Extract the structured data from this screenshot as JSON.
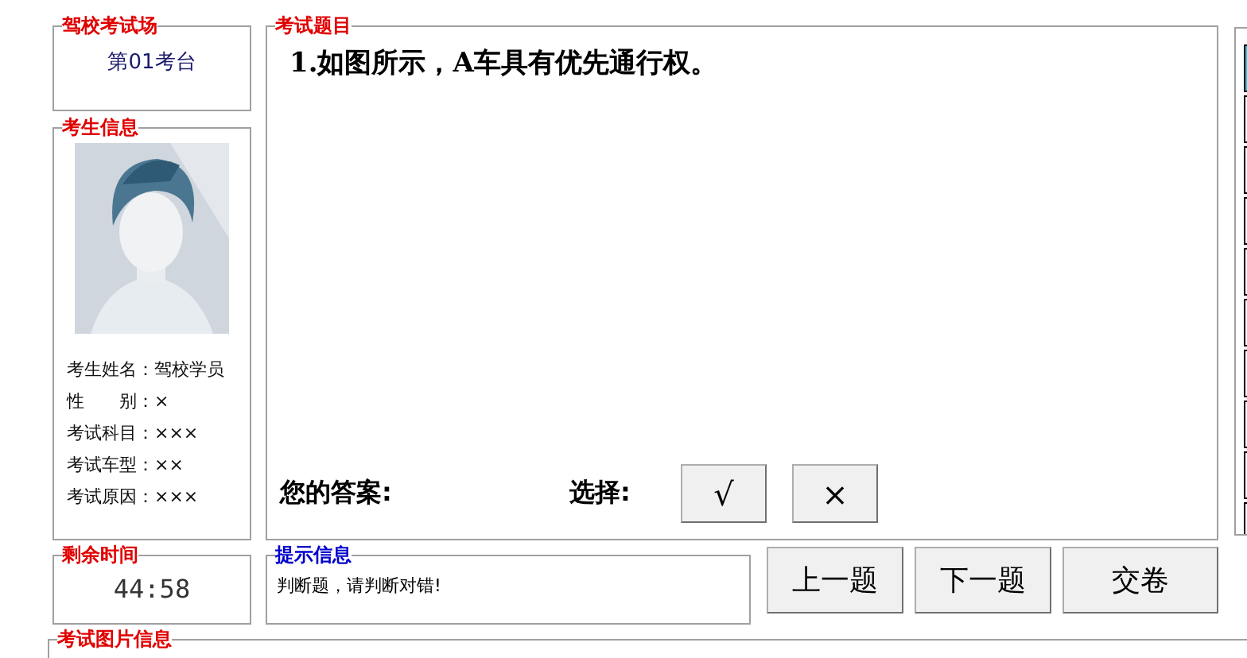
{
  "venue": {
    "title": "驾校考试场",
    "value": "第01考台"
  },
  "candidate": {
    "title": "考生信息",
    "fields": [
      {
        "label": "考生姓名：",
        "value": "驾校学员"
      },
      {
        "label": "性　　别：",
        "value": "×"
      },
      {
        "label": "考试科目：",
        "value": "×××"
      },
      {
        "label": "考试车型：",
        "value": "××"
      },
      {
        "label": "考试原因：",
        "value": "×××"
      }
    ]
  },
  "timer": {
    "title": "剩余时间",
    "value": "44:58"
  },
  "question": {
    "title": "考试题目",
    "text": "1.如图所示，A车具有优先通行权。",
    "answer_label": "您的答案:",
    "choice_label": "选择:",
    "choices": [
      "√",
      "×"
    ]
  },
  "hint": {
    "title": "提示信息",
    "text": "判断题，请判断对错!"
  },
  "nav_buttons": [
    "上一题",
    "下一题",
    "交卷"
  ],
  "picture_info": {
    "title": "考试图片信息"
  },
  "side_panel": {
    "cells": [
      {
        "selected": true
      },
      {
        "selected": false
      },
      {
        "selected": false
      },
      {
        "selected": false
      },
      {
        "selected": false
      },
      {
        "selected": false
      },
      {
        "selected": false
      },
      {
        "selected": false
      },
      {
        "selected": false
      },
      {
        "selected": false
      }
    ]
  }
}
